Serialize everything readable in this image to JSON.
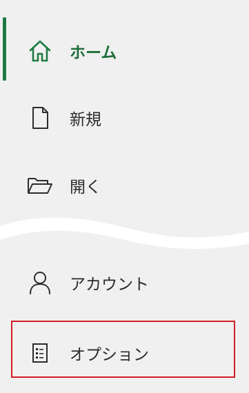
{
  "nav": {
    "home": {
      "label": "ホーム",
      "icon": "home-icon",
      "active": true
    },
    "new": {
      "label": "新規",
      "icon": "new-document-icon"
    },
    "open": {
      "label": "開く",
      "icon": "folder-open-icon"
    },
    "account": {
      "label": "アカウント",
      "icon": "person-icon"
    },
    "options": {
      "label": "オプション",
      "icon": "options-icon",
      "highlighted": true
    }
  },
  "colors": {
    "active_accent": "#1e7a43",
    "active_text": "#1e6e3a",
    "highlight_border": "#d11d24",
    "background": "#f0f0f0"
  }
}
